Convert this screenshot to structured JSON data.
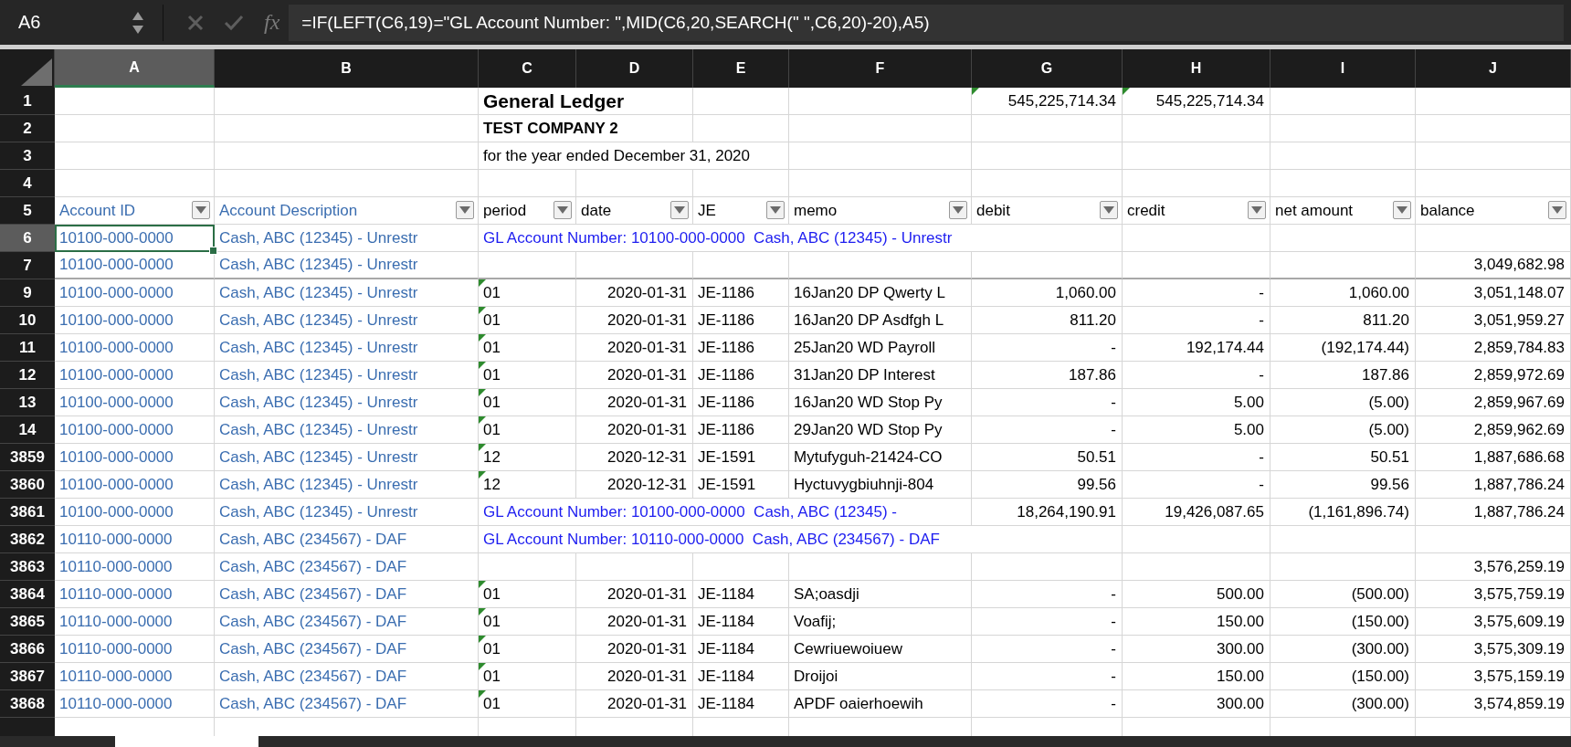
{
  "formula_bar": {
    "name_box": "A6",
    "function_label": "fx",
    "formula": "=IF(LEFT(C6,19)=\"GL Account Number: \",MID(C6,20,SEARCH(\" \",C6,20)-20),A5)"
  },
  "columns": [
    {
      "label": "A",
      "selected": true
    },
    {
      "label": "B",
      "selected": false
    },
    {
      "label": "C",
      "selected": false
    },
    {
      "label": "D",
      "selected": false
    },
    {
      "label": "E",
      "selected": false
    },
    {
      "label": "F",
      "selected": false
    },
    {
      "label": "G",
      "selected": false
    },
    {
      "label": "H",
      "selected": false
    },
    {
      "label": "I",
      "selected": false
    },
    {
      "label": "J",
      "selected": false
    }
  ],
  "rows": [
    {
      "header": "1",
      "kind": "title",
      "selected": false,
      "hidden_below": false,
      "cells": [
        null,
        null,
        "General Ledger",
        null,
        null,
        null,
        {
          "text": "545,225,714.34",
          "flagged": true
        },
        {
          "text": "545,225,714.34",
          "flagged": true
        },
        null,
        null
      ]
    },
    {
      "header": "2",
      "kind": "subtitle",
      "selected": false,
      "hidden_below": false,
      "cells": [
        null,
        null,
        "TEST COMPANY 2",
        null,
        null,
        null,
        null,
        null,
        null,
        null
      ]
    },
    {
      "header": "3",
      "kind": "text",
      "selected": false,
      "hidden_below": false,
      "cells": [
        null,
        null,
        "for the year ended December 31, 2020",
        null,
        null,
        null,
        null,
        null,
        null,
        null
      ]
    },
    {
      "header": "4",
      "kind": "text",
      "selected": false,
      "hidden_below": false,
      "cells": [
        null,
        null,
        null,
        null,
        null,
        null,
        null,
        null,
        null,
        null
      ]
    },
    {
      "header": "5",
      "kind": "header",
      "selected": false,
      "hidden_below": false,
      "cells": [
        "Account ID",
        "Account Description",
        "period",
        "date",
        "JE",
        "memo",
        "debit",
        "credit",
        "net amount",
        "balance"
      ]
    },
    {
      "header": "6",
      "kind": "gl_line",
      "selected": true,
      "hidden_below": false,
      "cells": [
        "10100-000-0000",
        "Cash, ABC (12345) - Unrestr",
        "GL Account Number: 10100-000-0000  Cash, ABC (12345) - Unrestr",
        null,
        null,
        null,
        null,
        null,
        null,
        null
      ]
    },
    {
      "header": "7",
      "kind": "detail",
      "selected": false,
      "hidden_below": true,
      "cells": [
        "10100-000-0000",
        "Cash, ABC (12345) - Unrestr",
        null,
        null,
        null,
        null,
        null,
        null,
        null,
        "3,049,682.98"
      ]
    },
    {
      "header": "9",
      "kind": "detail",
      "selected": false,
      "hidden_below": false,
      "cells": [
        "10100-000-0000",
        "Cash, ABC (12345) - Unrestr",
        {
          "text": "01",
          "flagged": true
        },
        "2020-01-31",
        "JE-1186",
        "16Jan20 DP Qwerty L",
        "1,060.00",
        "-",
        "1,060.00",
        "3,051,148.07"
      ]
    },
    {
      "header": "10",
      "kind": "detail",
      "selected": false,
      "hidden_below": false,
      "cells": [
        "10100-000-0000",
        "Cash, ABC (12345) - Unrestr",
        {
          "text": "01",
          "flagged": true
        },
        "2020-01-31",
        "JE-1186",
        "16Jan20 DP Asdfgh L",
        "811.20",
        "-",
        "811.20",
        "3,051,959.27"
      ]
    },
    {
      "header": "11",
      "kind": "detail",
      "selected": false,
      "hidden_below": false,
      "cells": [
        "10100-000-0000",
        "Cash, ABC (12345) - Unrestr",
        {
          "text": "01",
          "flagged": true
        },
        "2020-01-31",
        "JE-1186",
        "25Jan20 WD Payroll",
        "-",
        "192,174.44",
        "(192,174.44)",
        "2,859,784.83"
      ]
    },
    {
      "header": "12",
      "kind": "detail",
      "selected": false,
      "hidden_below": false,
      "cells": [
        "10100-000-0000",
        "Cash, ABC (12345) - Unrestr",
        {
          "text": "01",
          "flagged": true
        },
        "2020-01-31",
        "JE-1186",
        "31Jan20 DP Interest",
        "187.86",
        "-",
        "187.86",
        "2,859,972.69"
      ]
    },
    {
      "header": "13",
      "kind": "detail",
      "selected": false,
      "hidden_below": false,
      "cells": [
        "10100-000-0000",
        "Cash, ABC (12345) - Unrestr",
        {
          "text": "01",
          "flagged": true
        },
        "2020-01-31",
        "JE-1186",
        "16Jan20 WD Stop Py",
        "-",
        "5.00",
        "(5.00)",
        "2,859,967.69"
      ]
    },
    {
      "header": "14",
      "kind": "detail",
      "selected": false,
      "hidden_below": false,
      "cells": [
        "10100-000-0000",
        "Cash, ABC (12345) - Unrestr",
        {
          "text": "01",
          "flagged": true
        },
        "2020-01-31",
        "JE-1186",
        "29Jan20 WD Stop Py",
        "-",
        "5.00",
        "(5.00)",
        "2,859,962.69"
      ]
    },
    {
      "header": "3859",
      "kind": "detail",
      "selected": false,
      "hidden_below": false,
      "cells": [
        "10100-000-0000",
        "Cash, ABC (12345) - Unrestr",
        {
          "text": "12",
          "flagged": true
        },
        "2020-12-31",
        "JE-1591",
        "Mytufyguh-21424-CO",
        "50.51",
        "-",
        "50.51",
        "1,887,686.68"
      ]
    },
    {
      "header": "3860",
      "kind": "detail",
      "selected": false,
      "hidden_below": false,
      "cells": [
        "10100-000-0000",
        "Cash, ABC (12345) - Unrestr",
        {
          "text": "12",
          "flagged": true
        },
        "2020-12-31",
        "JE-1591",
        "Hyctuvygbiuhnji-804",
        "99.56",
        "-",
        "99.56",
        "1,887,786.24"
      ]
    },
    {
      "header": "3861",
      "kind": "gl_line",
      "selected": false,
      "hidden_below": false,
      "cells": [
        "10100-000-0000",
        "Cash, ABC (12345) - Unrestr",
        "GL Account Number: 10100-000-0000  Cash, ABC (12345) -",
        null,
        null,
        null,
        "18,264,190.91",
        "19,426,087.65",
        "(1,161,896.74)",
        "1,887,786.24"
      ]
    },
    {
      "header": "3862",
      "kind": "gl_line",
      "selected": false,
      "hidden_below": false,
      "cells": [
        "10110-000-0000",
        "Cash, ABC (234567) - DAF",
        "GL Account Number: 10110-000-0000  Cash, ABC (234567) - DAF",
        null,
        null,
        null,
        null,
        null,
        null,
        null
      ]
    },
    {
      "header": "3863",
      "kind": "detail",
      "selected": false,
      "hidden_below": false,
      "cells": [
        "10110-000-0000",
        "Cash, ABC (234567) - DAF",
        null,
        null,
        null,
        null,
        null,
        null,
        null,
        "3,576,259.19"
      ]
    },
    {
      "header": "3864",
      "kind": "detail",
      "selected": false,
      "hidden_below": false,
      "cells": [
        "10110-000-0000",
        "Cash, ABC (234567) - DAF",
        {
          "text": "01",
          "flagged": true
        },
        "2020-01-31",
        "JE-1184",
        "SA;oasdji",
        "-",
        "500.00",
        "(500.00)",
        "3,575,759.19"
      ]
    },
    {
      "header": "3865",
      "kind": "detail",
      "selected": false,
      "hidden_below": false,
      "cells": [
        "10110-000-0000",
        "Cash, ABC (234567) - DAF",
        {
          "text": "01",
          "flagged": true
        },
        "2020-01-31",
        "JE-1184",
        "Voafij;",
        "-",
        "150.00",
        "(150.00)",
        "3,575,609.19"
      ]
    },
    {
      "header": "3866",
      "kind": "detail",
      "selected": false,
      "hidden_below": false,
      "cells": [
        "10110-000-0000",
        "Cash, ABC (234567) - DAF",
        {
          "text": "01",
          "flagged": true
        },
        "2020-01-31",
        "JE-1184",
        "Cewriuewoiuew",
        "-",
        "300.00",
        "(300.00)",
        "3,575,309.19"
      ]
    },
    {
      "header": "3867",
      "kind": "detail",
      "selected": false,
      "hidden_below": false,
      "cells": [
        "10110-000-0000",
        "Cash, ABC (234567) - DAF",
        {
          "text": "01",
          "flagged": true
        },
        "2020-01-31",
        "JE-1184",
        "Droijoi",
        "-",
        "150.00",
        "(150.00)",
        "3,575,159.19"
      ]
    },
    {
      "header": "3868",
      "kind": "detail",
      "selected": false,
      "hidden_below": false,
      "cells": [
        "10110-000-0000",
        "Cash, ABC (234567) - DAF",
        {
          "text": "01",
          "flagged": true
        },
        "2020-01-31",
        "JE-1184",
        "APDF oaierhoewih",
        "-",
        "300.00",
        "(300.00)",
        "3,574,859.19"
      ]
    }
  ]
}
